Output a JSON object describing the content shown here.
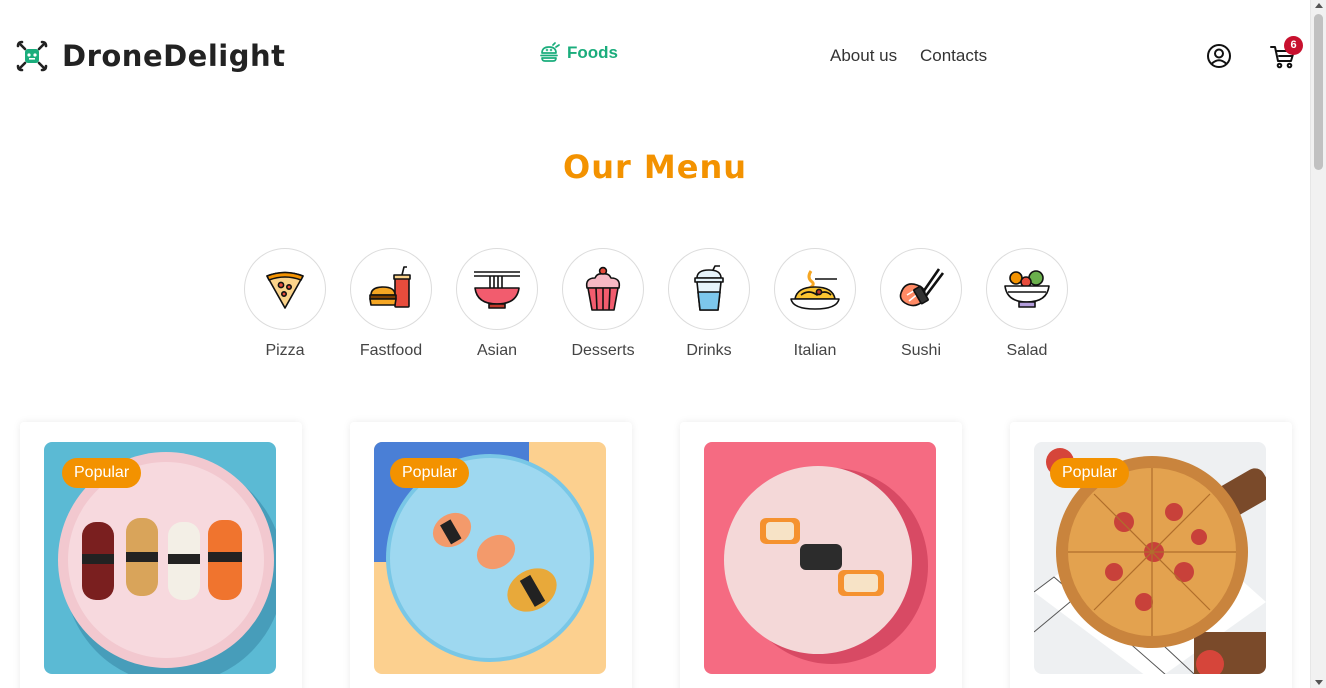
{
  "brand": {
    "name": "DroneDelight",
    "icon": "drone-icon",
    "accent": "#1aad7c"
  },
  "nav": {
    "foods": {
      "label": "Foods",
      "icon": "burger-icon",
      "color": "#1aad7c"
    },
    "about": "About us",
    "contacts": "Contacts",
    "user_icon": "user-icon",
    "cart_icon": "cart-icon",
    "cart_count": "6"
  },
  "menu": {
    "title": "Our Menu",
    "title_color": "#f39200",
    "categories": [
      {
        "label": "Pizza",
        "icon": "pizza-icon"
      },
      {
        "label": "Fastfood",
        "icon": "fastfood-icon"
      },
      {
        "label": "Asian",
        "icon": "noodle-bowl-icon"
      },
      {
        "label": "Desserts",
        "icon": "cupcake-icon"
      },
      {
        "label": "Drinks",
        "icon": "drink-cup-icon"
      },
      {
        "label": "Italian",
        "icon": "spaghetti-icon"
      },
      {
        "label": "Sushi",
        "icon": "sushi-icon"
      },
      {
        "label": "Salad",
        "icon": "salad-bowl-icon"
      }
    ]
  },
  "products": [
    {
      "badge": "Popular",
      "image": "nigiri-sushi-plate"
    },
    {
      "badge": "Popular",
      "image": "salmon-nigiri-blue-plate"
    },
    {
      "badge": "",
      "image": "maki-rolls-pink"
    },
    {
      "badge": "Popular",
      "image": "pepperoni-pizza"
    }
  ],
  "colors": {
    "badge": "#f39200",
    "cart_badge": "#c8102e"
  }
}
